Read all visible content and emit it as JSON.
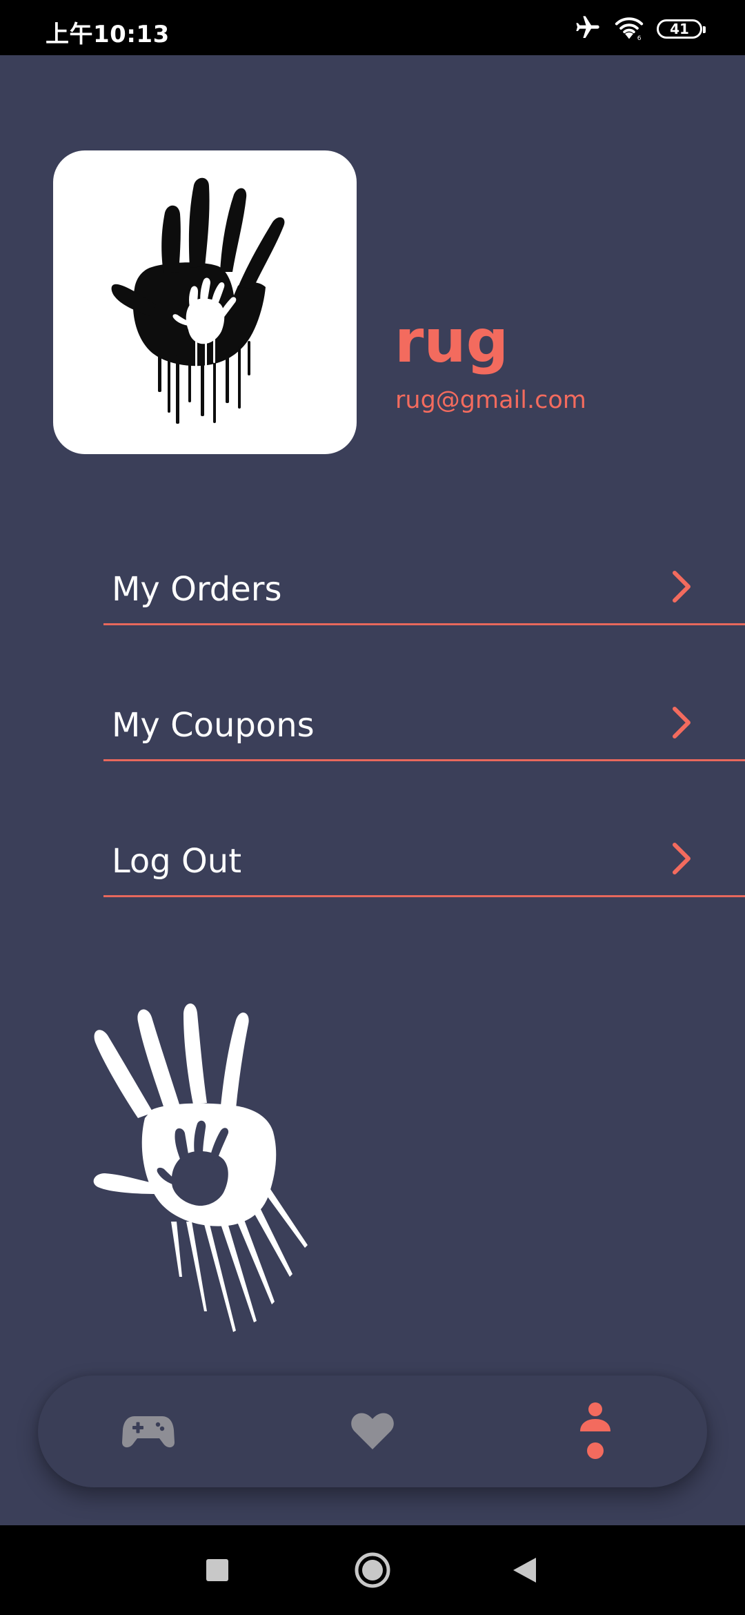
{
  "status_bar": {
    "time": "上午10:13",
    "battery": "41",
    "icons": [
      "airplane-mode-icon",
      "wifi-icon",
      "battery-icon"
    ]
  },
  "profile": {
    "name": "rug",
    "email": "rug@gmail.com",
    "avatar_icon": "handprint-icon"
  },
  "menu": {
    "items": [
      {
        "label": "My Orders",
        "icon": "chevron-right-icon"
      },
      {
        "label": "My Coupons",
        "icon": "chevron-right-icon"
      },
      {
        "label": "Log Out",
        "icon": "chevron-right-icon"
      }
    ]
  },
  "bottom_nav": {
    "items": [
      {
        "icon": "gamepad-icon",
        "active": false
      },
      {
        "icon": "heart-icon",
        "active": false
      },
      {
        "icon": "profile-icon",
        "active": true
      }
    ]
  },
  "system_nav": [
    "recents-icon",
    "home-icon",
    "back-icon"
  ],
  "colors": {
    "background": "#3b3f59",
    "accent": "#f36b5e",
    "inactive_icon": "#8e8e95",
    "text": "#ffffff"
  }
}
